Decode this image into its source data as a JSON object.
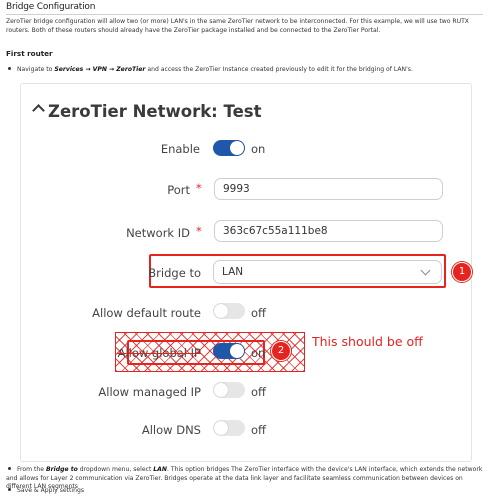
{
  "doc": {
    "heading": "Bridge Configuration",
    "intro": "ZeroTier bridge configuration will allow two (or more) LAN's in the same ZeroTier network to be interconnected. For this example, we will use two RUTX routers. Both of these routers should already have the ZeroTier package installed and be connected to the ZeroTier Portal.",
    "subheading": "First router",
    "step1_pre": "Navigate to ",
    "step1_path": "Services → VPN → ZeroTier",
    "step1_post": " and access the ZeroTier Instance created previously to edit it for the bridging of LAN's.",
    "step2_a": "From the ",
    "step2_b": "Bridge to",
    "step2_c": " dropdown menu, select ",
    "step2_d": "LAN",
    "step2_e": ". This option bridges The ZeroTier interface with the device's LAN interface, which extends the network and allows for Layer 2 communication via ZeroTier. Bridges operate at the data link layer and facilitate seamless communication between devices on different LAN segments",
    "step3": "Save & Apply settings"
  },
  "panel": {
    "title": "ZeroTier Network: Test",
    "enable": {
      "label": "Enable",
      "state": "on"
    },
    "port": {
      "label": "Port",
      "required": "*",
      "value": "9993"
    },
    "network_id": {
      "label": "Network ID",
      "required": "*",
      "value": "363c67c55a111be8"
    },
    "bridge_to": {
      "label": "Bridge to",
      "value": "LAN"
    },
    "allow_default_route": {
      "label": "Allow default route",
      "state": "off"
    },
    "allow_global_ip": {
      "label": "Allow global IP",
      "state": "on"
    },
    "allow_managed_ip": {
      "label": "Allow managed IP",
      "state": "off"
    },
    "allow_dns": {
      "label": "Allow DNS",
      "state": "off"
    }
  },
  "annotations": {
    "badge1": "1",
    "badge2": "2",
    "note": "This should be off"
  },
  "colors": {
    "toggle_on": "#1f58a8",
    "annotation_red": "#e52420",
    "required_red": "#e0242d"
  }
}
